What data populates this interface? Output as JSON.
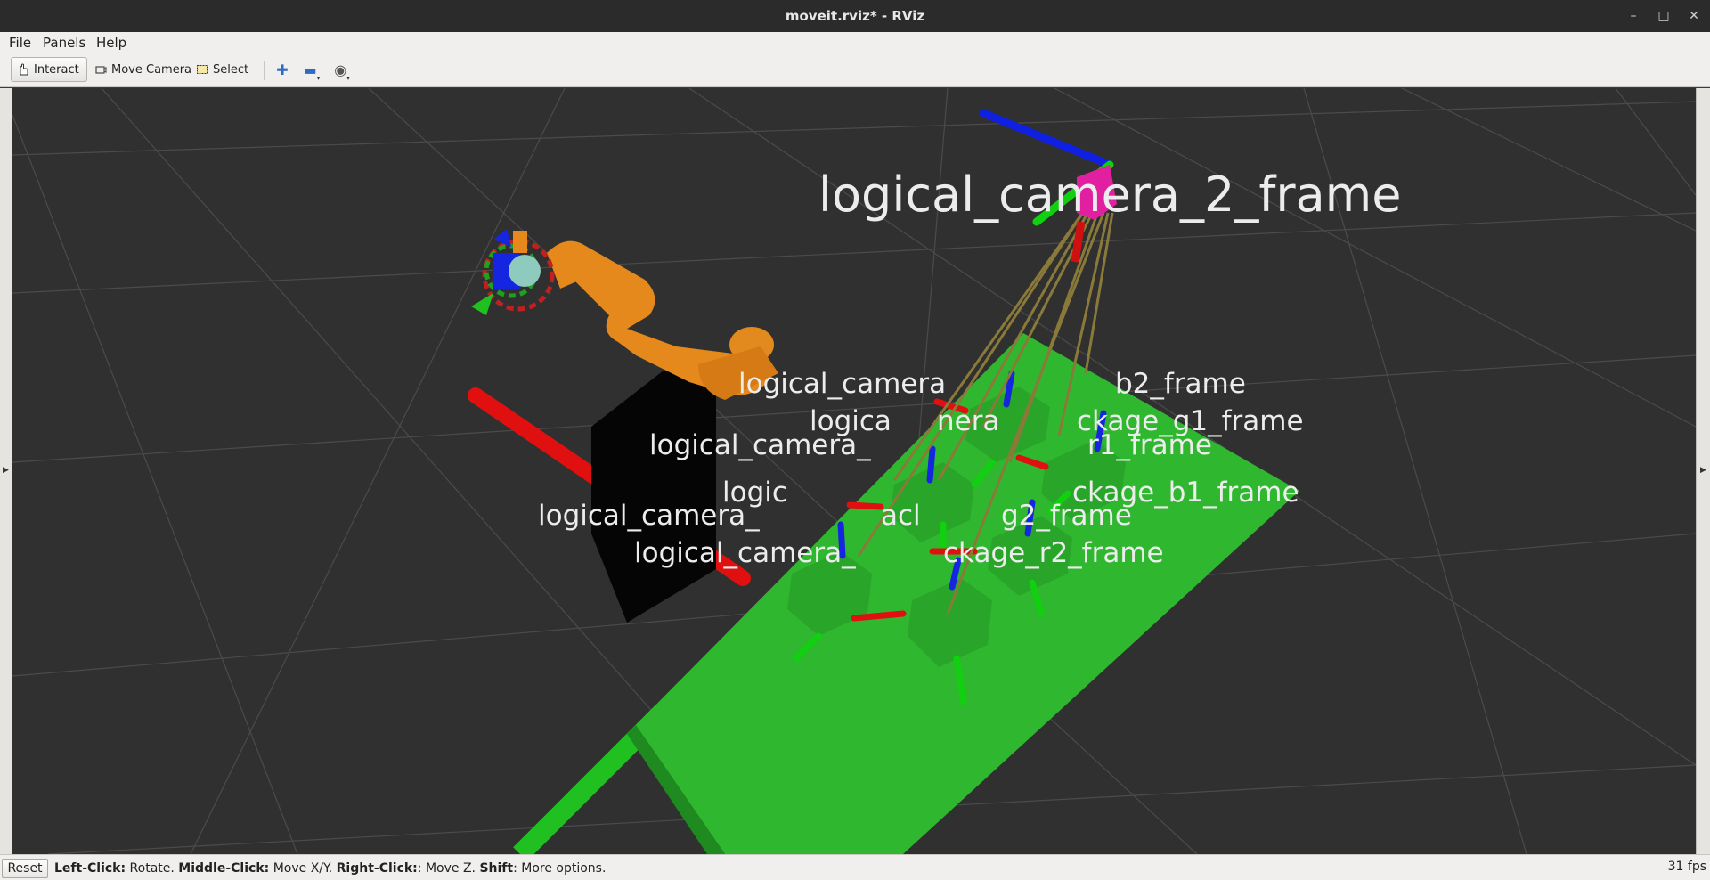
{
  "window": {
    "title": "moveit.rviz* - RViz"
  },
  "menu": [
    "File",
    "Panels",
    "Help"
  ],
  "toolbar": {
    "interact": "Interact",
    "move_camera": "Move Camera",
    "select": "Select"
  },
  "viewport": {
    "labels": [
      "logical_camera_2_frame",
      "logical_camera",
      "b2_frame",
      "logica",
      "nera",
      "ckage_g1_frame",
      "logical_camera_",
      "r1_frame",
      "logic",
      "ckage_b1_frame",
      "logical_camera_",
      "acl",
      "g2_frame",
      "logical_camera_",
      "ckage_r2_frame"
    ]
  },
  "status": {
    "reset": "Reset",
    "hint_parts": [
      {
        "bold": "Left-Click:",
        "text": " Rotate. "
      },
      {
        "bold": "Middle-Click:",
        "text": " Move X/Y. "
      },
      {
        "bold": "Right-Click:",
        "text": ": Move Z. "
      },
      {
        "bold": "Shift",
        "text": ": More options."
      }
    ],
    "fps": "31 fps"
  },
  "colors": {
    "grid_bg": "#303030",
    "grid_line": "#4a4a4a",
    "table_green": "#2fb82f",
    "robot_orange": "#e6891c",
    "axis_red": "#e01010",
    "axis_green": "#10d010",
    "axis_blue": "#1020e0"
  }
}
